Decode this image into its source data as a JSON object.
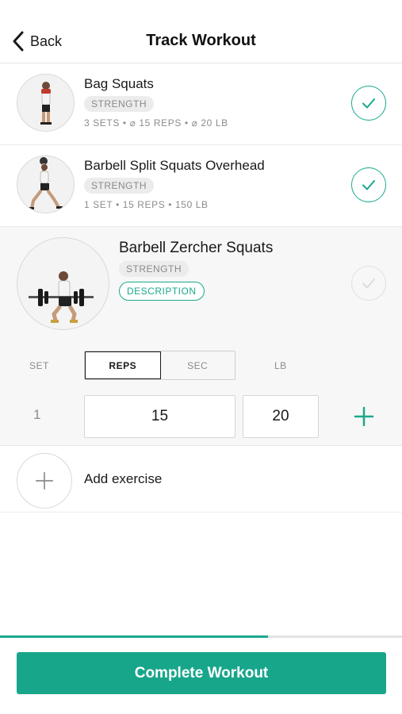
{
  "header": {
    "back_label": "Back",
    "title": "Track Workout"
  },
  "exercises": [
    {
      "name": "Bag Squats",
      "tag": "STRENGTH",
      "meta": "3 SETS • ⌀ 15 REPS • ⌀ 20 LB",
      "completed": true
    },
    {
      "name": "Barbell Split Squats Overhead",
      "tag": "STRENGTH",
      "meta": "1 SET • 15 REPS • 150 LB",
      "completed": true
    }
  ],
  "active": {
    "name": "Barbell Zercher Squats",
    "tag": "STRENGTH",
    "description_label": "DESCRIPTION",
    "completed": false,
    "columns": {
      "set": "SET",
      "reps": "REPS",
      "sec": "SEC",
      "lb": "LB"
    },
    "selected_mode": "REPS",
    "sets": [
      {
        "set": "1",
        "reps": "15",
        "lb": "20"
      }
    ]
  },
  "add": {
    "label": "Add exercise"
  },
  "progress": 0.667,
  "complete_label": "Complete Workout",
  "colors": {
    "accent": "#18a68b",
    "text": "#1a1a1a",
    "muted": "#8c8c8c"
  }
}
